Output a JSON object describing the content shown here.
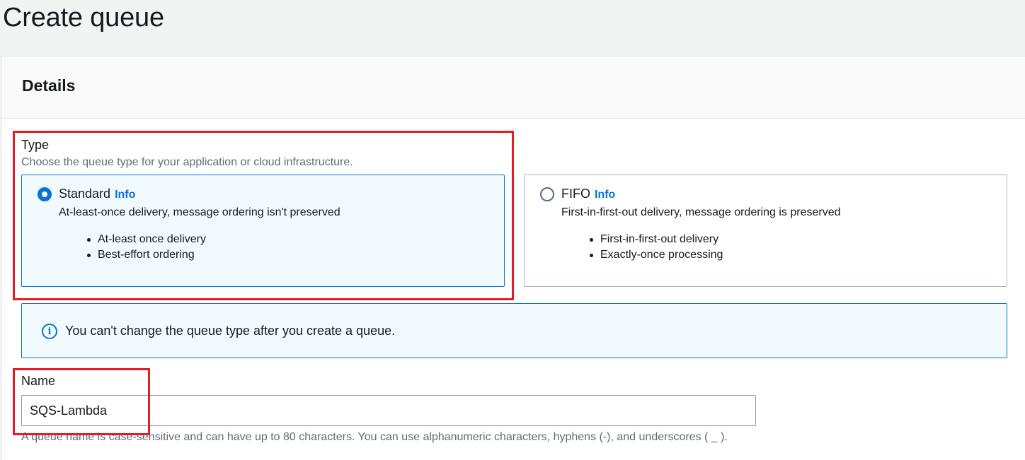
{
  "page": {
    "title": "Create queue"
  },
  "details": {
    "title": "Details",
    "type_field": {
      "label": "Type",
      "description": "Choose the queue type for your application or cloud infrastructure.",
      "options": [
        {
          "title": "Standard",
          "info": "Info",
          "description": "At-least-once delivery, message ordering isn't preserved",
          "bullets": [
            "At-least once delivery",
            "Best-effort ordering"
          ],
          "selected": true
        },
        {
          "title": "FIFO",
          "info": "Info",
          "description": "First-in-first-out delivery, message ordering is preserved",
          "bullets": [
            "First-in-first-out delivery",
            "Exactly-once processing"
          ],
          "selected": false
        }
      ]
    },
    "alert": {
      "icon": "info-icon",
      "text": "You can't change the queue type after you create a queue."
    },
    "name_field": {
      "label": "Name",
      "value": "SQS-Lambda",
      "description": "A queue name is case-sensitive and can have up to 80 characters. You can use alphanumeric characters, hyphens (-), and underscores ( _ )."
    }
  },
  "colors": {
    "accent": "#0972d3",
    "highlight": "#e01e26"
  }
}
